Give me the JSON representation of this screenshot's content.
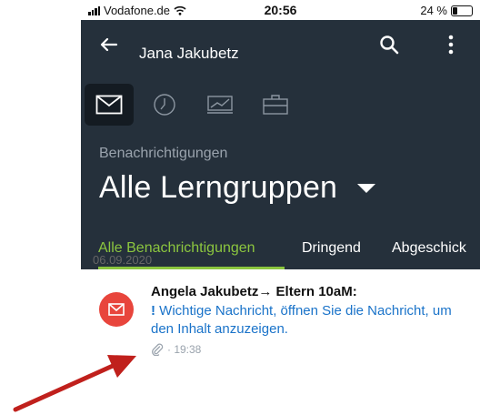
{
  "status": {
    "carrier": "Vodafone.de",
    "time": "20:56",
    "battery": "24 %"
  },
  "appbar": {
    "title": "Jana Jakubetz"
  },
  "header": {
    "subtitle": "Benachrichtigungen",
    "group": "Alle Lerngruppen"
  },
  "tabs": [
    "Alle Benachrichtigungen",
    "Dringend",
    "Abgeschick"
  ],
  "date": "06.09.2020",
  "notification": {
    "sender": "Angela Jakubetz→ Eltern 10aM:",
    "exclamation": "!",
    "message": "Wichtige Nachricht, öffnen Sie die Nachricht, um den Inhalt anzuzeigen.",
    "time": "· 19:38"
  },
  "colors": {
    "header_bg": "#25303b",
    "accent": "#8cc63f",
    "link": "#1a73c9",
    "avatar": "#e8453c",
    "annotation_arrow": "#c0201c"
  },
  "icons": [
    "envelope-icon",
    "clock-icon",
    "chart-icon",
    "briefcase-icon",
    "paperclip-icon",
    "back-arrow-icon",
    "search-icon",
    "more-vertical-icon"
  ]
}
